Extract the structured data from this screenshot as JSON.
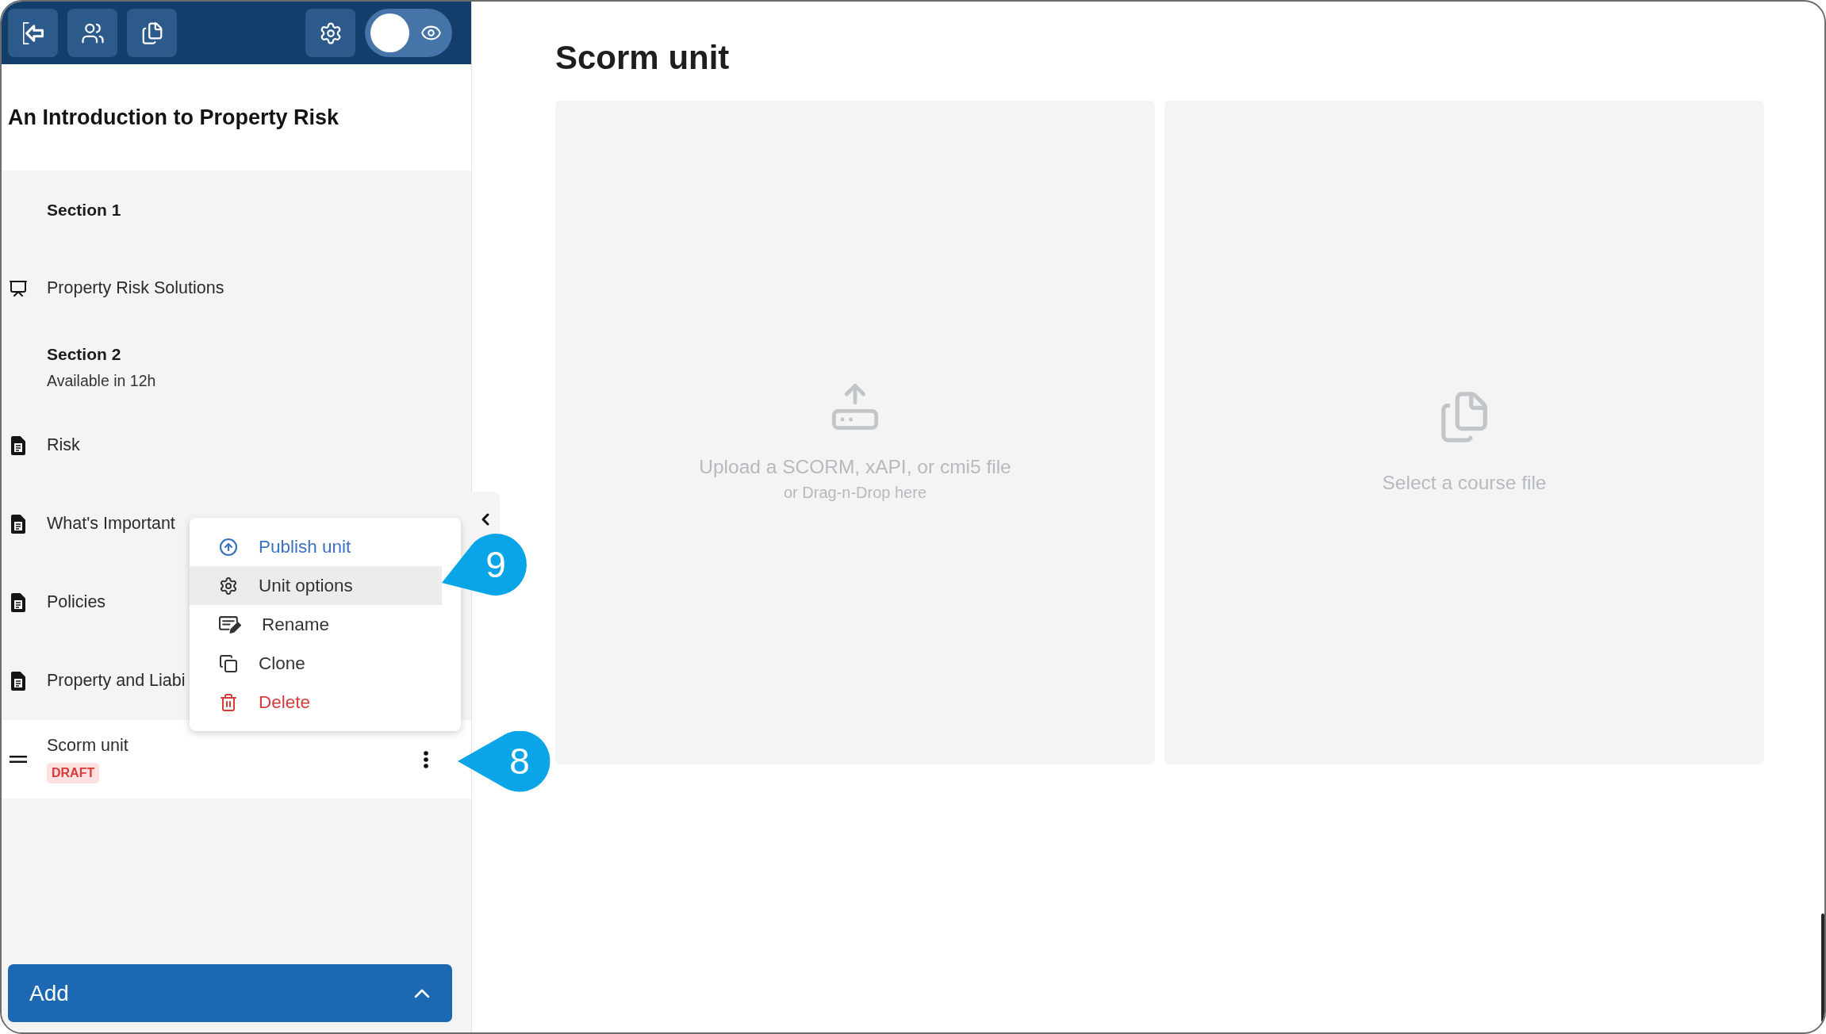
{
  "toolbar": {
    "preview_toggle": {
      "on": false
    }
  },
  "course_title": "An Introduction to Property Risk",
  "outline": [
    {
      "kind": "section",
      "title": "Section 1"
    },
    {
      "kind": "presentation",
      "title": "Property Risk Solutions",
      "selected": false
    },
    {
      "kind": "section",
      "title": "Section 2",
      "subtitle": "Available in 12h"
    },
    {
      "kind": "document",
      "title": "Risk",
      "selected": false
    },
    {
      "kind": "document",
      "title": "What's Important",
      "selected": false
    },
    {
      "kind": "document",
      "title": "Policies",
      "selected": false
    },
    {
      "kind": "document",
      "title": "Property and Liabi",
      "selected": false
    },
    {
      "kind": "scorm",
      "title": "Scorm unit",
      "selected": true,
      "badge": "DRAFT",
      "callout": "8"
    }
  ],
  "context_menu": {
    "items": [
      {
        "kind": "publish",
        "label": "Publish unit",
        "selected": false
      },
      {
        "kind": "options",
        "label": "Unit options",
        "selected": true,
        "callout": "9"
      },
      {
        "kind": "rename",
        "label": "Rename",
        "selected": false
      },
      {
        "kind": "clone",
        "label": "Clone",
        "selected": false
      },
      {
        "kind": "delete",
        "label": "Delete",
        "selected": false
      }
    ]
  },
  "main": {
    "title": "Scorm unit",
    "panels": [
      {
        "kind": "upload",
        "label": "Upload a SCORM, xAPI, or cmi5 file",
        "hint": "or Drag-n-Drop here"
      },
      {
        "kind": "select",
        "label": "Select a course file"
      }
    ]
  },
  "add_button": {
    "label": "Add"
  }
}
